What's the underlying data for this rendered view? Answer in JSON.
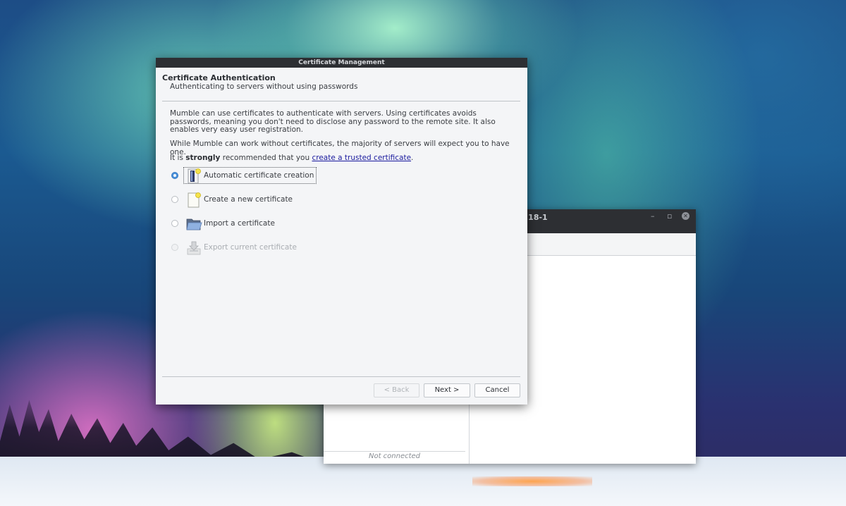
{
  "background_window": {
    "title": ".18-1",
    "minimize": "–",
    "restore": "▫",
    "close": "✕",
    "status": "Not connected"
  },
  "dialog": {
    "title": "Certificate Management",
    "header": {
      "title": "Certificate Authentication",
      "subtitle": "Authenticating to servers without using passwords"
    },
    "paragraph1": "Mumble can use certificates to authenticate with servers. Using certificates avoids passwords, meaning you don't need to disclose any password to the remote site. It also enables very easy user registration.",
    "paragraph2": "While Mumble can work without certificates, the majority of servers will expect you to have one.",
    "recommend": {
      "prefix": "It is ",
      "emphasis": "strongly",
      "middle": " recommended that you ",
      "link": "create a trusted certificate",
      "suffix": "."
    },
    "options": [
      {
        "label": "Automatic certificate creation",
        "icon": "auto-certificate-icon",
        "checked": true,
        "disabled": false
      },
      {
        "label": "Create a new certificate",
        "icon": "new-certificate-icon",
        "checked": false,
        "disabled": false
      },
      {
        "label": "Import a certificate",
        "icon": "folder-open-icon",
        "checked": false,
        "disabled": false
      },
      {
        "label": "Export current certificate",
        "icon": "export-certificate-icon",
        "checked": false,
        "disabled": true
      }
    ],
    "buttons": {
      "back": "< Back",
      "next": "Next >",
      "cancel": "Cancel"
    }
  },
  "colors": {
    "titlebar": "#2d2f33",
    "dialog_bg": "#f4f5f7",
    "radio_checked": "#4a90d9",
    "link": "#1a1a9e"
  }
}
